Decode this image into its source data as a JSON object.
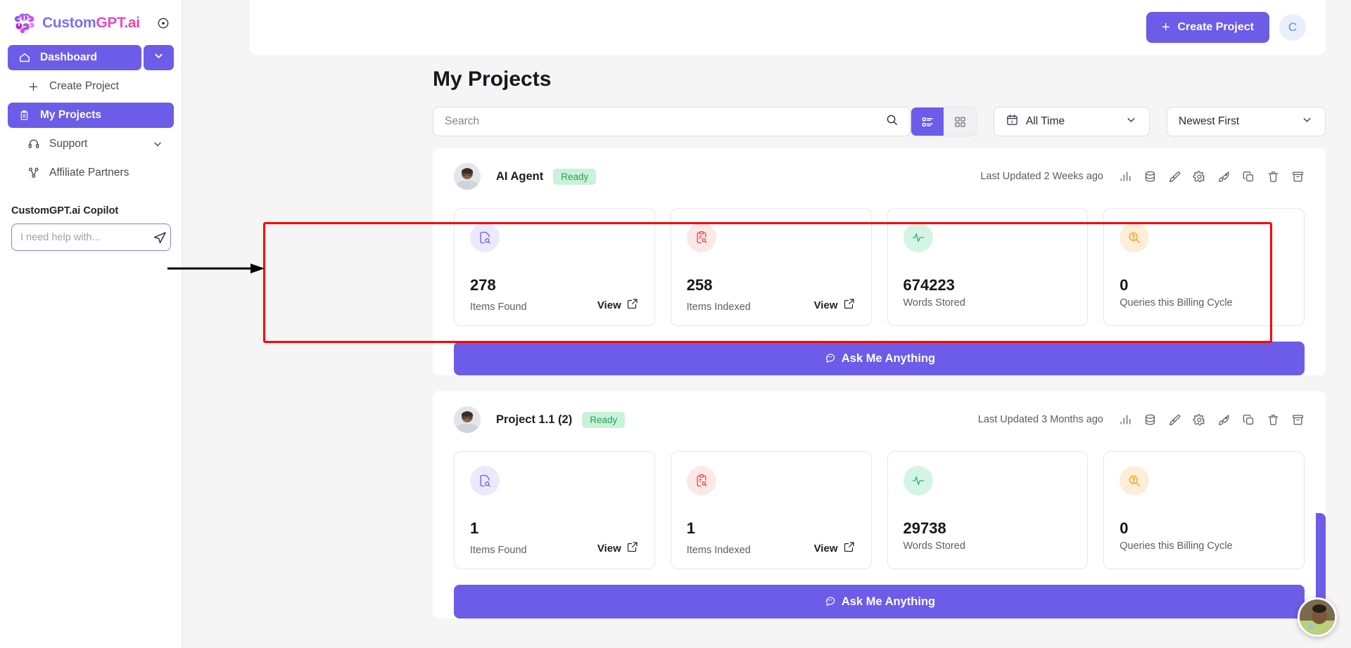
{
  "brand": {
    "name_parts": [
      "Custom",
      "GPT",
      ".ai"
    ],
    "full_name": "CustomGPT.ai",
    "collapse_icon": "collapse-circle-icon"
  },
  "sidebar": {
    "dashboard": {
      "label": "Dashboard",
      "icon": "home-icon",
      "chevron": "chevron-down-icon"
    },
    "items": [
      {
        "label": "Create Project",
        "icon": "plus-icon",
        "active": false
      },
      {
        "label": "My Projects",
        "icon": "clipboard-icon",
        "active": true
      },
      {
        "label": "Support",
        "icon": "headset-icon",
        "active": false,
        "chevron": "chevron-down-icon"
      },
      {
        "label": "Affiliate Partners",
        "icon": "share-nodes-icon",
        "active": false
      }
    ],
    "copilot": {
      "label": "CustomGPT.ai Copilot",
      "placeholder": "I need help with...",
      "value": "",
      "send_icon": "send-paper-plane-icon"
    }
  },
  "header": {
    "create_project_label": "Create Project",
    "create_project_icon": "plus-icon",
    "avatar_initial": "C"
  },
  "main": {
    "page_title": "My Projects",
    "search": {
      "placeholder": "Search",
      "value": "",
      "icon": "search-icon"
    },
    "view_toggle": {
      "list_icon": "list-view-icon",
      "grid_icon": "grid-view-icon",
      "selected": "list"
    },
    "filters": [
      {
        "name": "time-range",
        "label": "All Time",
        "icon": "calendar-icon",
        "chevron": "chevron-down-icon"
      },
      {
        "name": "sort-order",
        "label": "Newest First",
        "icon": "",
        "chevron": "chevron-down-icon"
      }
    ]
  },
  "action_icons": [
    "analytics-bar-chart-icon",
    "database-icon",
    "paintbrush-icon",
    "gear-icon",
    "rocket-icon",
    "copy-icon",
    "trash-icon",
    "archive-icon"
  ],
  "projects": [
    {
      "name": "AI Agent",
      "status": "Ready",
      "last_updated": "Last Updated 2 Weeks ago",
      "avatar": "user-avatar",
      "ama_label": "Ask Me Anything",
      "ama_icon": "chat-bubble-icon",
      "stats": [
        {
          "value": "278",
          "label": "Items Found",
          "icon": "file-search-icon",
          "icon_color": "#6c5ce7",
          "icon_bg": "#ece9fd",
          "view_label": "View",
          "view_icon": "external-link-icon",
          "has_view": true
        },
        {
          "value": "258",
          "label": "Items Indexed",
          "icon": "clipboard-search-icon",
          "icon_color": "#ef4444",
          "icon_bg": "#fde8e8",
          "view_label": "View",
          "view_icon": "external-link-icon",
          "has_view": true
        },
        {
          "value": "674223",
          "label": "Words Stored",
          "icon": "activity-pulse-icon",
          "icon_color": "#22b573",
          "icon_bg": "#d4f5e4",
          "view_label": "",
          "view_icon": "",
          "has_view": false
        },
        {
          "value": "0",
          "label": "Queries this Billing Cycle",
          "icon": "query-search-icon",
          "icon_color": "#f59e0b",
          "icon_bg": "#fdeeda",
          "view_label": "",
          "view_icon": "",
          "has_view": false
        }
      ]
    },
    {
      "name": "Project 1.1 (2)",
      "status": "Ready",
      "last_updated": "Last Updated 3 Months ago",
      "avatar": "user-avatar",
      "ama_label": "Ask Me Anything",
      "ama_icon": "chat-bubble-icon",
      "stats": [
        {
          "value": "1",
          "label": "Items Found",
          "icon": "file-search-icon",
          "icon_color": "#6c5ce7",
          "icon_bg": "#ece9fd",
          "view_label": "View",
          "view_icon": "external-link-icon",
          "has_view": true
        },
        {
          "value": "1",
          "label": "Items Indexed",
          "icon": "clipboard-search-icon",
          "icon_color": "#ef4444",
          "icon_bg": "#fde8e8",
          "view_label": "View",
          "view_icon": "external-link-icon",
          "has_view": true
        },
        {
          "value": "29738",
          "label": "Words Stored",
          "icon": "activity-pulse-icon",
          "icon_color": "#22b573",
          "icon_bg": "#d4f5e4",
          "view_label": "",
          "view_icon": "",
          "has_view": false
        },
        {
          "value": "0",
          "label": "Queries this Billing Cycle",
          "icon": "query-search-icon",
          "icon_color": "#f59e0b",
          "icon_bg": "#fdeeda",
          "view_label": "",
          "view_icon": "",
          "has_view": false
        }
      ]
    }
  ],
  "annotations": {
    "highlight_box_color": "#ff0000",
    "arrow_color": "#000000",
    "arrow_points_to": "stats-row-project-1"
  },
  "colors": {
    "accent": "#6c5ce7",
    "ready_badge_bg": "#c9f2d8",
    "ready_badge_text": "#25a35a",
    "page_bg": "#f5f5f5"
  }
}
